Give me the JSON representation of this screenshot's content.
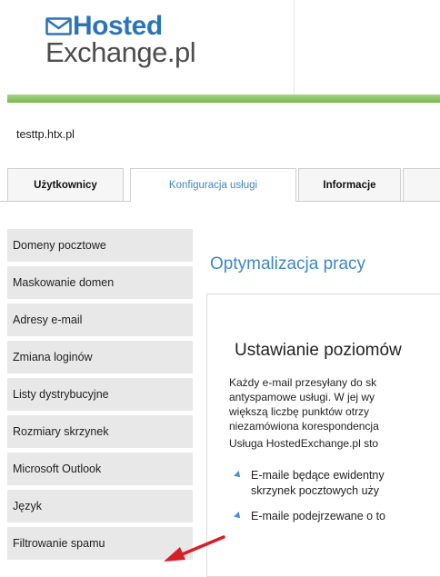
{
  "brand": {
    "logo_top": "Hosted",
    "logo_bottom": "Exchange.pl",
    "accent_color": "#3d87c7",
    "band_color": "#74b64b"
  },
  "account": {
    "domain": "testtp.htx.pl"
  },
  "tabs": [
    {
      "label": "Użytkownicy",
      "active": false
    },
    {
      "label": "Konfiguracja usługi",
      "active": true
    },
    {
      "label": "Informacje",
      "active": false
    }
  ],
  "sidebar": {
    "items": [
      {
        "label": "Domeny pocztowe"
      },
      {
        "label": "Maskowanie domen"
      },
      {
        "label": "Adresy e-mail"
      },
      {
        "label": "Zmiana loginów"
      },
      {
        "label": "Listy dystrybucyjne"
      },
      {
        "label": "Rozmiary skrzynek"
      },
      {
        "label": "Microsoft Outlook"
      },
      {
        "label": "Język"
      },
      {
        "label": "Filtrowanie spamu"
      }
    ]
  },
  "main": {
    "title": "Optymalizacja pracy",
    "section_title": "Ustawianie poziomów",
    "paragraph_lines": [
      "Każdy e-mail przesyłany do sk",
      "antyspamowe usługi. W jej wy",
      "większą liczbę punktów otrzy",
      "niezamówiona korespondencja"
    ],
    "note": "Usługa HostedExchange.pl sto",
    "bullets": [
      {
        "line1": "E-maile będące ewidentny",
        "line2": "skrzynek pocztowych uży"
      },
      {
        "line1": "E-maile podejrzewane o to",
        "line2": ""
      }
    ]
  },
  "annotation": {
    "arrow_color": "#d71f26"
  }
}
